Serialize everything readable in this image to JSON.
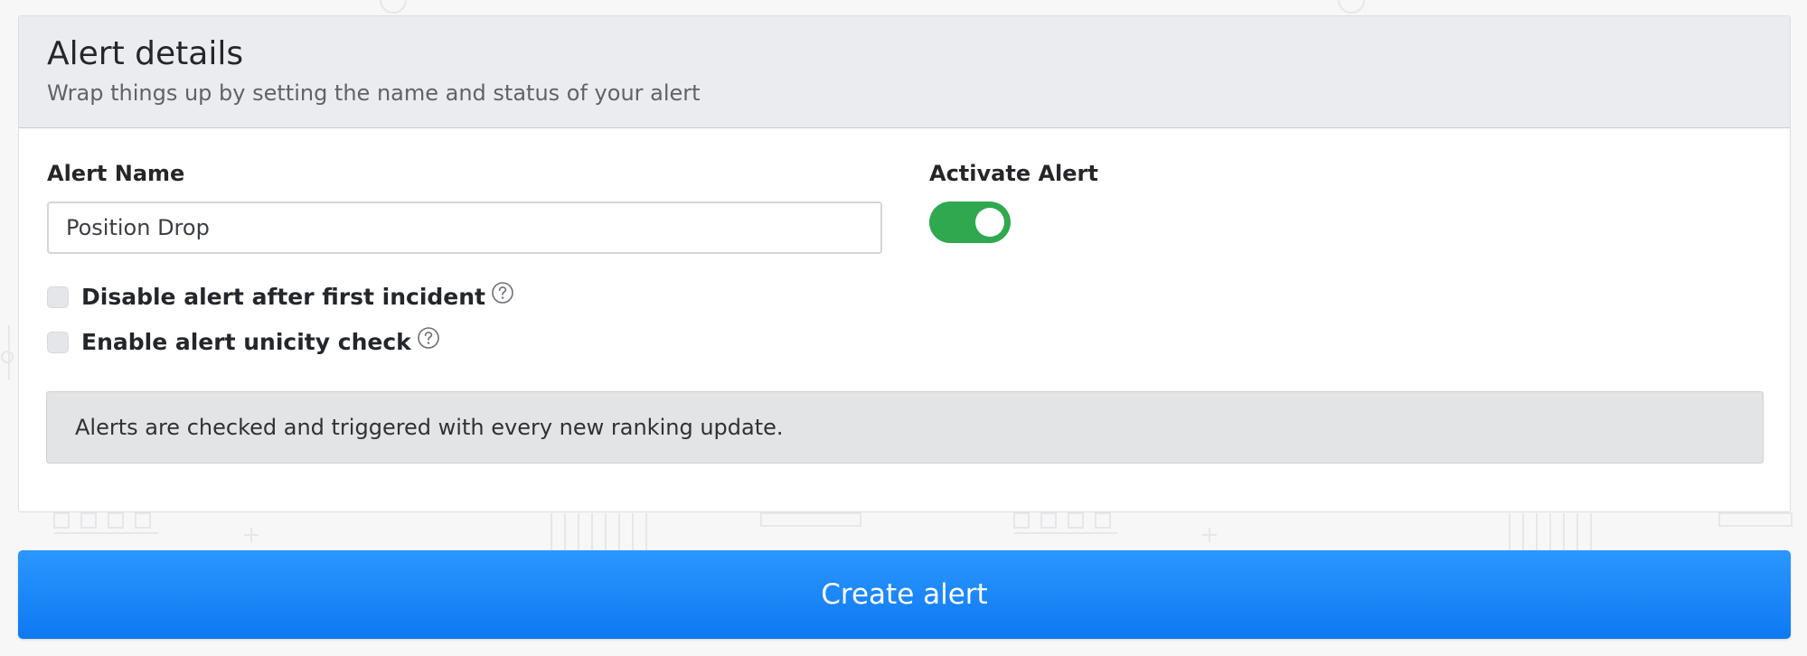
{
  "card": {
    "title": "Alert details",
    "subtitle": "Wrap things up by setting the name and status of your alert"
  },
  "alert_name": {
    "label": "Alert Name",
    "value": "Position Drop"
  },
  "activate": {
    "label": "Activate Alert",
    "enabled": true
  },
  "options": [
    {
      "label": "Disable alert after first incident",
      "checked": false,
      "help_icon": "question-circle-icon"
    },
    {
      "label": "Enable alert unicity check",
      "checked": false,
      "help_icon": "question-circle-icon"
    }
  ],
  "notice": {
    "text": "Alerts are checked and triggered with every new ranking update."
  },
  "actions": {
    "create_label": "Create alert"
  },
  "colors": {
    "primary_button": "#1a85fa",
    "toggle_on": "#2fa84f",
    "header_bg": "#ebecef",
    "notice_bg": "#e3e4e6"
  }
}
